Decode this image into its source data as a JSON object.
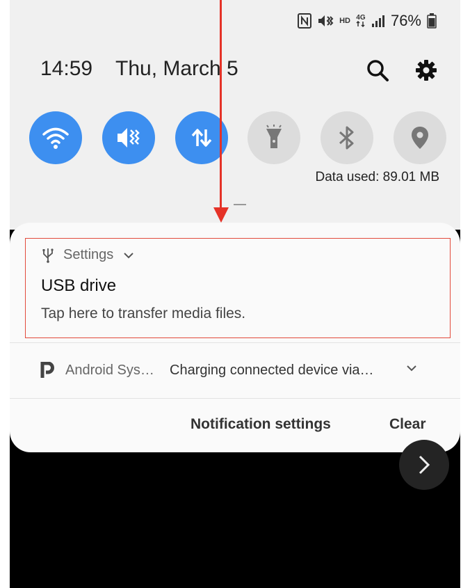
{
  "status_bar": {
    "icons": [
      "nfc-icon",
      "vibrate-mute-icon",
      "hd-icon",
      "4g-data-icon",
      "signal-icon",
      "battery-icon"
    ],
    "hd": "HD",
    "network": "4G",
    "battery_percent": "76%"
  },
  "header": {
    "time": "14:59",
    "date": "Thu, March 5"
  },
  "quick_toggles": [
    {
      "name": "wifi",
      "state": "on"
    },
    {
      "name": "sound-mute-vibrate",
      "state": "on"
    },
    {
      "name": "mobile-data",
      "state": "on"
    },
    {
      "name": "flashlight",
      "state": "off"
    },
    {
      "name": "bluetooth",
      "state": "off"
    },
    {
      "name": "location",
      "state": "off"
    }
  ],
  "data_used": "Data used: 89.01 MB",
  "notifications": {
    "usb": {
      "app": "Settings",
      "title": "USB drive",
      "text": "Tap here to transfer media files."
    },
    "android": {
      "app": "Android Sys…",
      "text": "Charging connected device via…"
    }
  },
  "actions": {
    "notification_settings": "Notification settings",
    "clear": "Clear"
  },
  "colors": {
    "toggle_on": "#3d8ff0",
    "toggle_off": "#dcdcdc",
    "annotation": "#e53227"
  }
}
